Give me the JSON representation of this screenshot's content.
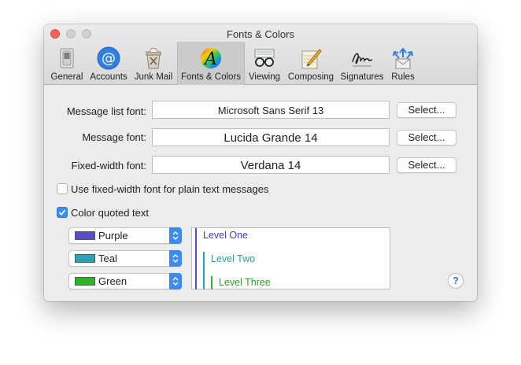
{
  "window": {
    "title": "Fonts & Colors"
  },
  "toolbar": {
    "items": [
      {
        "label": "General",
        "icon": "general-switch-icon"
      },
      {
        "label": "Accounts",
        "icon": "accounts-at-icon"
      },
      {
        "label": "Junk Mail",
        "icon": "junk-mail-bin-icon"
      },
      {
        "label": "Fonts & Colors",
        "icon": "fonts-colors-icon",
        "active": true
      },
      {
        "label": "Viewing",
        "icon": "viewing-glasses-icon"
      },
      {
        "label": "Composing",
        "icon": "composing-pencil-icon"
      },
      {
        "label": "Signatures",
        "icon": "signature-icon"
      },
      {
        "label": "Rules",
        "icon": "rules-arrows-icon"
      }
    ]
  },
  "fonts": {
    "message_list": {
      "label": "Message list font:",
      "value": "Microsoft Sans Serif 13",
      "button": "Select..."
    },
    "message": {
      "label": "Message font:",
      "value": "Lucida Grande 14",
      "button": "Select..."
    },
    "fixed_width": {
      "label": "Fixed-width font:",
      "value": "Verdana 14",
      "button": "Select..."
    }
  },
  "options": {
    "fixed_width_plain": {
      "label": "Use fixed-width font for plain text messages",
      "checked": false
    },
    "color_quoted": {
      "label": "Color quoted text",
      "checked": true
    }
  },
  "quote_colors": [
    {
      "name": "Purple",
      "color": "#5a4bd0"
    },
    {
      "name": "Teal",
      "color": "#2aa3b5"
    },
    {
      "name": "Green",
      "color": "#2fb32a"
    }
  ],
  "preview": {
    "levels": [
      {
        "text": "Level One",
        "color": "#4a3fb8"
      },
      {
        "text": "Level Two",
        "color": "#2a9aad"
      },
      {
        "text": "Level Three",
        "color": "#2aa125"
      }
    ]
  },
  "help": {
    "label": "?"
  }
}
